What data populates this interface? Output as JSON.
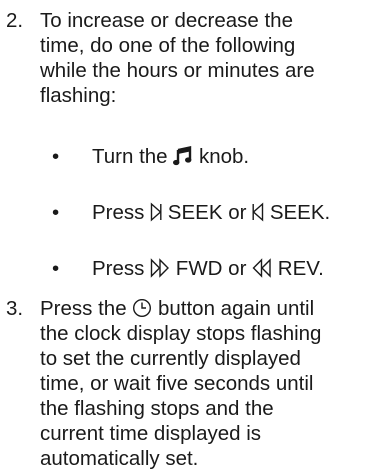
{
  "steps": [
    {
      "number": "2.",
      "lines": [
        "To increase or decrease the",
        "time, do one of the following",
        "while the hours or minutes are",
        "flashing:"
      ]
    },
    {
      "number": "3.",
      "lines": [
        "the clock display stops flashing",
        "to set the currently displayed",
        "time, or wait five seconds until",
        "the flashing stops and the",
        "current time displayed is",
        "automatically set."
      ],
      "first_line_before_icon": "Press the ",
      "first_line_after_icon": " button again until",
      "icon": "clock-icon"
    }
  ],
  "bullets": [
    {
      "bullet": "•",
      "before": "Turn the ",
      "icon": "music-note-icon",
      "after": " knob."
    },
    {
      "bullet": "•",
      "before": "Press ",
      "icon1": "seek-forward-icon",
      "mid": " SEEK or ",
      "icon2": "seek-back-icon",
      "after": " SEEK."
    },
    {
      "bullet": "•",
      "before": "Press ",
      "icon1": "fast-forward-icon",
      "mid": " FWD or ",
      "icon2": "rewind-icon",
      "after": " REV."
    }
  ]
}
